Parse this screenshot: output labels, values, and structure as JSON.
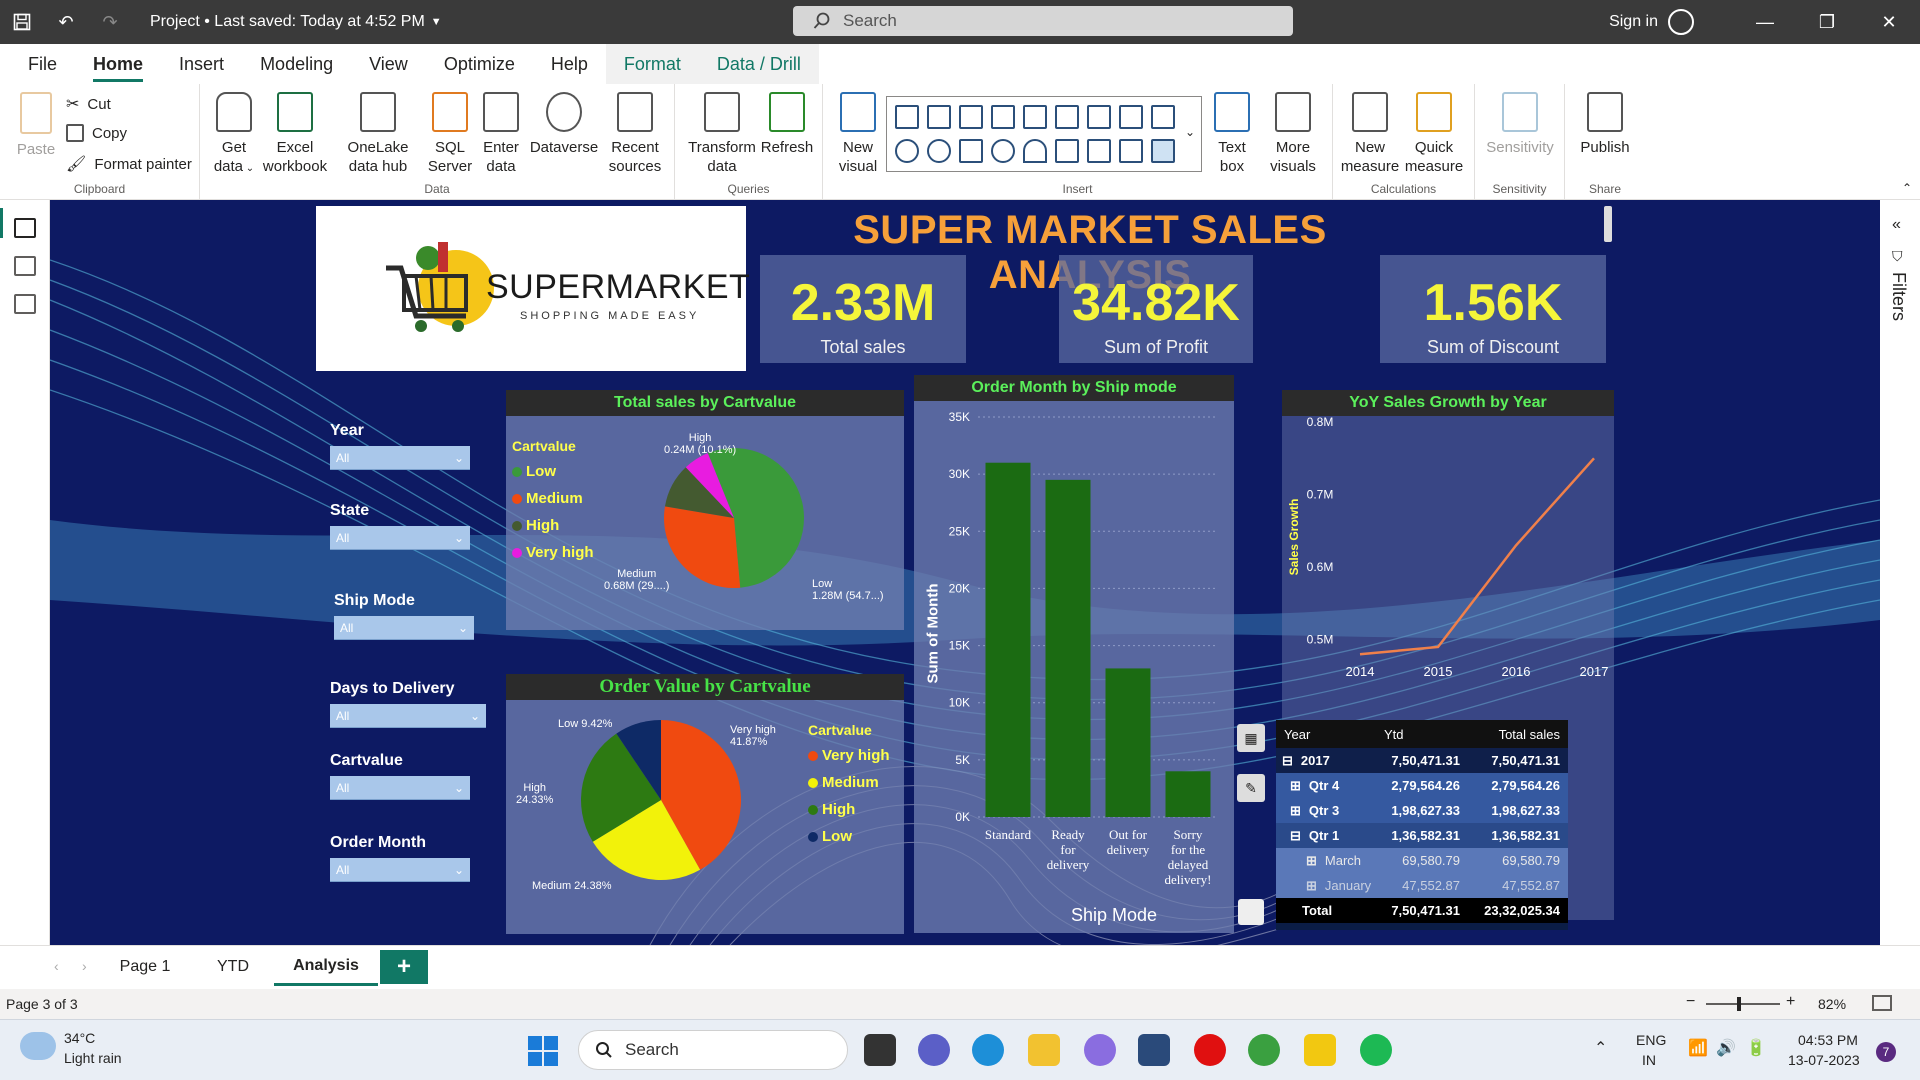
{
  "titlebar": {
    "title": "Project • Last saved: Today at 4:52 PM",
    "search_placeholder": "Search",
    "signin": "Sign in"
  },
  "menu": [
    "File",
    "Home",
    "Insert",
    "Modeling",
    "View",
    "Optimize",
    "Help",
    "Format",
    "Data / Drill"
  ],
  "ribbon": {
    "clipboard": {
      "paste": "Paste",
      "cut": "Cut",
      "copy": "Copy",
      "format_painter": "Format painter",
      "label": "Clipboard"
    },
    "data": {
      "get_data": "Get data",
      "excel": "Excel workbook",
      "onelake": "OneLake data hub",
      "sql": "SQL Server",
      "enter": "Enter data",
      "dataverse": "Dataverse",
      "recent": "Recent sources",
      "label": "Data"
    },
    "queries": {
      "transform": "Transform data",
      "refresh": "Refresh",
      "label": "Queries"
    },
    "insert": {
      "new_visual": "New visual",
      "text_box": "Text box",
      "more_visuals": "More visuals",
      "label": "Insert"
    },
    "calculations": {
      "new_measure": "New measure",
      "quick_measure": "Quick measure",
      "label": "Calculations"
    },
    "sensitivity": {
      "btn": "Sensitivity",
      "label": "Sensitivity"
    },
    "share": {
      "publish": "Publish",
      "label": "Share"
    }
  },
  "rightrail": {
    "filters": "Filters"
  },
  "report": {
    "title": "SUPER MARKET SALES ANALYSIS",
    "logo": {
      "brand": "SUPERMARKET",
      "tagline": "SHOPPING MADE EASY"
    },
    "kpis": [
      {
        "value": "2.33M",
        "label": "Total sales"
      },
      {
        "value": "34.82K",
        "label": "Sum of Profit"
      },
      {
        "value": "1.56K",
        "label": "Sum of Discount"
      }
    ],
    "slicers": [
      {
        "title": "Year",
        "value": "All"
      },
      {
        "title": "State",
        "value": "All"
      },
      {
        "title": "Ship Mode",
        "value": "All"
      },
      {
        "title": "Days to Delivery",
        "value": "All"
      },
      {
        "title": "Cartvalue",
        "value": "All"
      },
      {
        "title": "Order Month",
        "value": "All"
      }
    ],
    "pie1": {
      "title": "Total sales by Cartvalue",
      "legend_title": "Cartvalue",
      "legend": [
        "Low",
        "Medium",
        "High",
        "Very high"
      ],
      "labels": {
        "high_name": "High",
        "high_val": "0.24M (10.1%)",
        "medium_name": "Medium",
        "medium_val": "0.68M (29....)",
        "low_name": "Low",
        "low_val": "1.28M (54.7...)"
      }
    },
    "pie2": {
      "title": "Order Value by Cartvalue",
      "legend_title": "Cartvalue",
      "legend": [
        "Very high",
        "Medium",
        "High",
        "Low"
      ],
      "labels": {
        "low": "Low 9.42%",
        "very_high": "Very high",
        "very_high_pct": "41.87%",
        "high": "High",
        "high_pct": "24.33%",
        "medium": "Medium 24.38%"
      }
    },
    "bar": {
      "title": "Order Month by Ship mode",
      "ylabel": "Sum of Month",
      "xlabel": "Ship Mode"
    },
    "line": {
      "title": "YoY Sales Growth by Year",
      "ylabel": "Sales Growth"
    },
    "matrix": {
      "headers": [
        "Year",
        "Ytd",
        "Total sales"
      ],
      "rows": [
        {
          "label": "2017",
          "ytd": "7,50,471.31",
          "total": "7,50,471.31",
          "sym": "⊟"
        },
        {
          "label": "Qtr 4",
          "ytd": "2,79,564.26",
          "total": "2,79,564.26",
          "sym": "⊞"
        },
        {
          "label": "Qtr 3",
          "ytd": "1,98,627.33",
          "total": "1,98,627.33",
          "sym": "⊞"
        },
        {
          "label": "Qtr 1",
          "ytd": "1,36,582.31",
          "total": "1,36,582.31",
          "sym": "⊟"
        },
        {
          "label": "March",
          "ytd": "69,580.79",
          "total": "69,580.79",
          "sym": "⊞"
        },
        {
          "label": "January",
          "ytd": "47,552.87",
          "total": "47,552.87",
          "sym": "⊞"
        }
      ],
      "total": {
        "label": "Total",
        "ytd": "7,50,471.31",
        "total": "23,32,025.34"
      }
    }
  },
  "chart_data": [
    {
      "type": "pie",
      "title": "Total sales by Cartvalue",
      "categories": [
        "Low",
        "Medium",
        "High",
        "Very high"
      ],
      "values": [
        1.28,
        0.68,
        0.24,
        0.14
      ],
      "unit": "M",
      "colors": [
        "#3a9a3a",
        "#f04a10",
        "#445a30",
        "#e81ce0"
      ]
    },
    {
      "type": "pie",
      "title": "Order Value by Cartvalue",
      "categories": [
        "Very high",
        "Medium",
        "High",
        "Low"
      ],
      "values": [
        41.87,
        24.38,
        24.33,
        9.42
      ],
      "unit": "%",
      "colors": [
        "#f04a10",
        "#f2f20a",
        "#2d7a12",
        "#0e2a66"
      ]
    },
    {
      "type": "bar",
      "title": "Order Month by Ship mode",
      "categories": [
        "Standard",
        "Ready for delivery",
        "Out for delivery",
        "Sorry for the delayed delivery!"
      ],
      "values": [
        31000,
        29500,
        13000,
        4000
      ],
      "ylim": [
        0,
        35000
      ],
      "yticks": [
        "0K",
        "5K",
        "10K",
        "15K",
        "20K",
        "25K",
        "30K",
        "35K"
      ],
      "xlabel": "Ship Mode",
      "ylabel": "Sum of Month",
      "color": "#1b6b12"
    },
    {
      "type": "line",
      "title": "YoY Sales Growth by Year",
      "x": [
        "2014",
        "2015",
        "2016",
        "2017"
      ],
      "values": [
        0.48,
        0.49,
        0.63,
        0.75
      ],
      "ylim": [
        0.45,
        0.8
      ],
      "yticks": [
        "0.5M",
        "0.6M",
        "0.7M",
        "0.8M"
      ],
      "ylabel": "Sales Growth",
      "color": "#f0804a"
    }
  ],
  "pages": {
    "items": [
      "Page 1",
      "YTD",
      "Analysis"
    ],
    "active": "Analysis",
    "status": "Page 3 of 3",
    "zoom": "82%"
  },
  "taskbar": {
    "weather_temp": "34°C",
    "weather_desc": "Light rain",
    "search": "Search",
    "lang1": "ENG",
    "lang2": "IN",
    "time": "04:53 PM",
    "date": "13-07-2023",
    "badge": "7"
  }
}
